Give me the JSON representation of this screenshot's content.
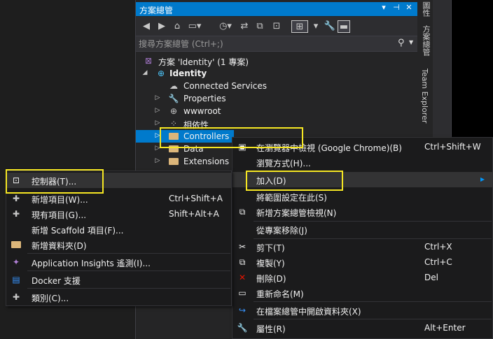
{
  "panel": {
    "title": "方案總管",
    "title_buttons": [
      "▾",
      "⊣",
      "✕"
    ],
    "search_placeholder": "搜尋方案總管 (Ctrl+;)"
  },
  "side_tabs": [
    "方案總管",
    "Team Explorer"
  ],
  "side_tab_top": "圖性",
  "tree": {
    "solution": "方案 'Identity' (1 專案)",
    "project": "Identity",
    "items": {
      "connected": "Connected Services",
      "properties": "Properties",
      "wwwroot": "wwwroot",
      "deps": "相依性",
      "controllers": "Controllers",
      "data": "Data",
      "extensions": "Extensions"
    }
  },
  "context_menu": {
    "items": [
      {
        "label": "在瀏覽器中檢視 (Google Chrome)(B)",
        "shortcut": "Ctrl+Shift+W",
        "icon": "browser-icon"
      },
      {
        "label": "瀏覽方式(H)...",
        "shortcut": "",
        "icon": ""
      },
      {
        "label": "加入(D)",
        "shortcut": "",
        "icon": "",
        "submenu": true
      },
      {
        "label": "將範圍設定在此(S)",
        "shortcut": "",
        "icon": ""
      },
      {
        "label": "新增方案總管檢視(N)",
        "shortcut": "",
        "icon": "new-view-icon"
      },
      {
        "label": "從專案移除(J)",
        "shortcut": "",
        "icon": ""
      },
      {
        "label": "剪下(T)",
        "shortcut": "Ctrl+X",
        "icon": "cut-icon"
      },
      {
        "label": "複製(Y)",
        "shortcut": "Ctrl+C",
        "icon": "copy-icon"
      },
      {
        "label": "刪除(D)",
        "shortcut": "Del",
        "icon": "delete-icon"
      },
      {
        "label": "重新命名(M)",
        "shortcut": "",
        "icon": "rename-icon"
      },
      {
        "label": "在檔案總管中開啟資料夾(X)",
        "shortcut": "",
        "icon": "open-folder-icon"
      },
      {
        "label": "屬性(R)",
        "shortcut": "Alt+Enter",
        "icon": "wrench-icon"
      }
    ],
    "submenu_arrow": "▸"
  },
  "add_submenu": {
    "items": [
      {
        "label": "控制器(T)...",
        "shortcut": "",
        "icon": "controller-icon"
      },
      {
        "label": "新增項目(W)...",
        "shortcut": "Ctrl+Shift+A",
        "icon": "new-item-icon"
      },
      {
        "label": "現有項目(G)...",
        "shortcut": "Shift+Alt+A",
        "icon": "existing-item-icon"
      },
      {
        "label": "新增 Scaffold 項目(F)...",
        "shortcut": "",
        "icon": ""
      },
      {
        "label": "新增資料夾(D)",
        "shortcut": "",
        "icon": "new-folder-icon"
      },
      {
        "label": "Application Insights 遙測(I)...",
        "shortcut": "",
        "icon": "insights-icon"
      },
      {
        "label": "Docker 支援",
        "shortcut": "",
        "icon": "docker-icon"
      },
      {
        "label": "類別(C)...",
        "shortcut": "",
        "icon": "class-icon"
      }
    ]
  },
  "colors": {
    "accent": "#007acc",
    "highlight_box": "#f5e623",
    "folder": "#dcb67a"
  }
}
